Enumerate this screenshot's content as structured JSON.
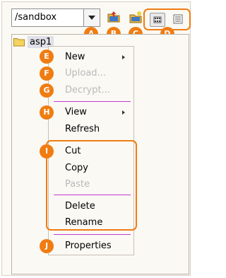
{
  "toolbar": {
    "path_value": "/sandbox",
    "icons": [
      "upload-icon",
      "new-folder-icon"
    ],
    "view_icons": [
      "grid-view-icon",
      "list-view-icon"
    ]
  },
  "tree": {
    "items": [
      {
        "label": "asp1",
        "icon": "folder-icon"
      }
    ]
  },
  "context_menu": {
    "items": [
      {
        "label": "New",
        "disabled": false,
        "submenu": true
      },
      {
        "label": "Upload...",
        "disabled": true
      },
      {
        "label": "Decrypt...",
        "disabled": true
      },
      {
        "label": "View",
        "disabled": false,
        "submenu": true
      },
      {
        "label": "Refresh",
        "disabled": false
      },
      {
        "label": "Cut",
        "disabled": false
      },
      {
        "label": "Copy",
        "disabled": false
      },
      {
        "label": "Paste",
        "disabled": true
      },
      {
        "label": "Delete",
        "disabled": false
      },
      {
        "label": "Rename",
        "disabled": false
      },
      {
        "label": "Properties",
        "disabled": false
      }
    ]
  },
  "callouts": {
    "a": "A",
    "b": "B",
    "c": "C",
    "d": "D",
    "e": "E",
    "f": "F",
    "g": "G",
    "h": "H",
    "i": "I",
    "j": "J"
  },
  "colors": {
    "callout": "#f07c12",
    "separator": "#c23bd2",
    "disabled_text": "#b9b9b9",
    "panel_bg": "#fbf9f4",
    "selection_bg": "#dfe0e8"
  }
}
